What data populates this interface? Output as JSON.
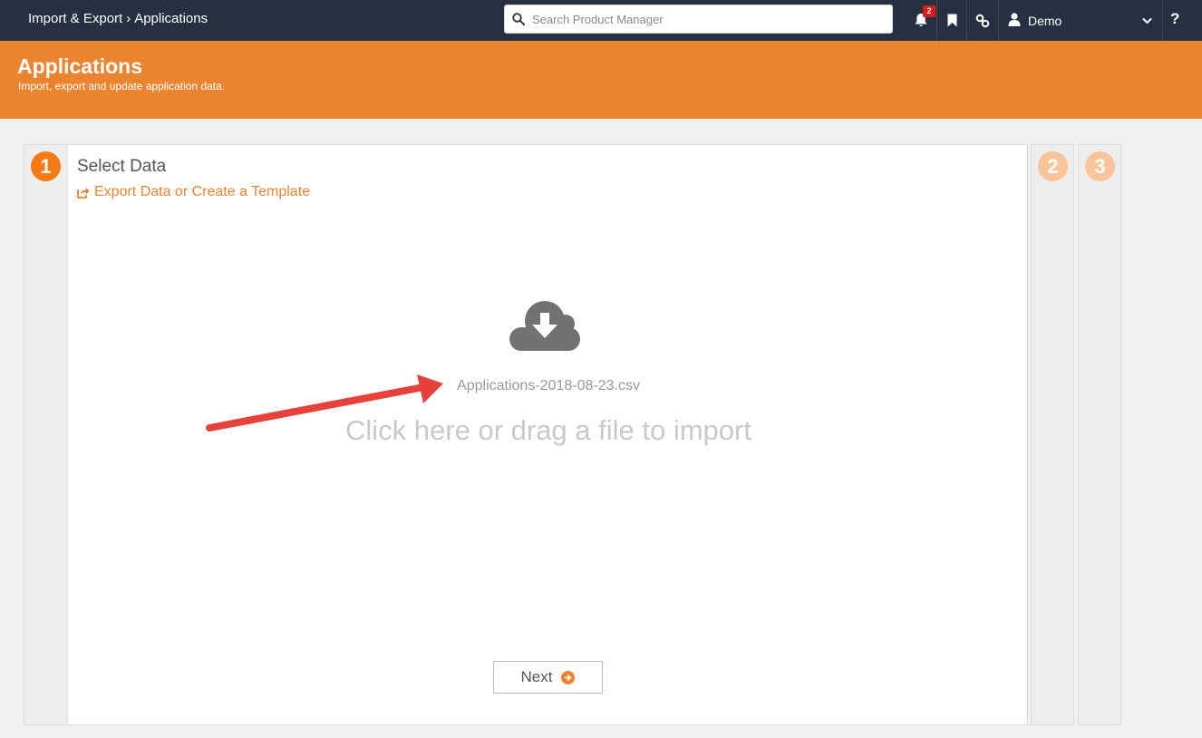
{
  "topbar": {
    "breadcrumb": [
      "Import & Export",
      "Applications"
    ],
    "breadcrumb_separator": "›",
    "search_placeholder": "Search Product Manager",
    "notification_count": "2",
    "user_name": "Demo",
    "help_label": "?",
    "icons": [
      "search-icon",
      "bell-icon",
      "bookmark-icon",
      "link-icon",
      "user-icon",
      "chevron-down-icon"
    ]
  },
  "header": {
    "title": "Applications",
    "subtitle": "Import, export and update application data."
  },
  "wizard": {
    "steps": [
      "1",
      "2",
      "3"
    ],
    "active_step": 1,
    "step1": {
      "title": "Select Data",
      "export_link": "Export Data or Create a Template",
      "file_name": "Applications-2018-08-23.csv",
      "drop_prompt": "Click here or drag a file to import",
      "next_label": "Next"
    }
  },
  "annotation": {
    "type": "arrow",
    "color": "#e8403a",
    "points_to": "file-name"
  },
  "colors": {
    "topbar": "#263040",
    "accent": "#ec842f",
    "step_active": "#f57a13",
    "step_inactive": "#f9c49a",
    "badge": "#e01a1a"
  }
}
